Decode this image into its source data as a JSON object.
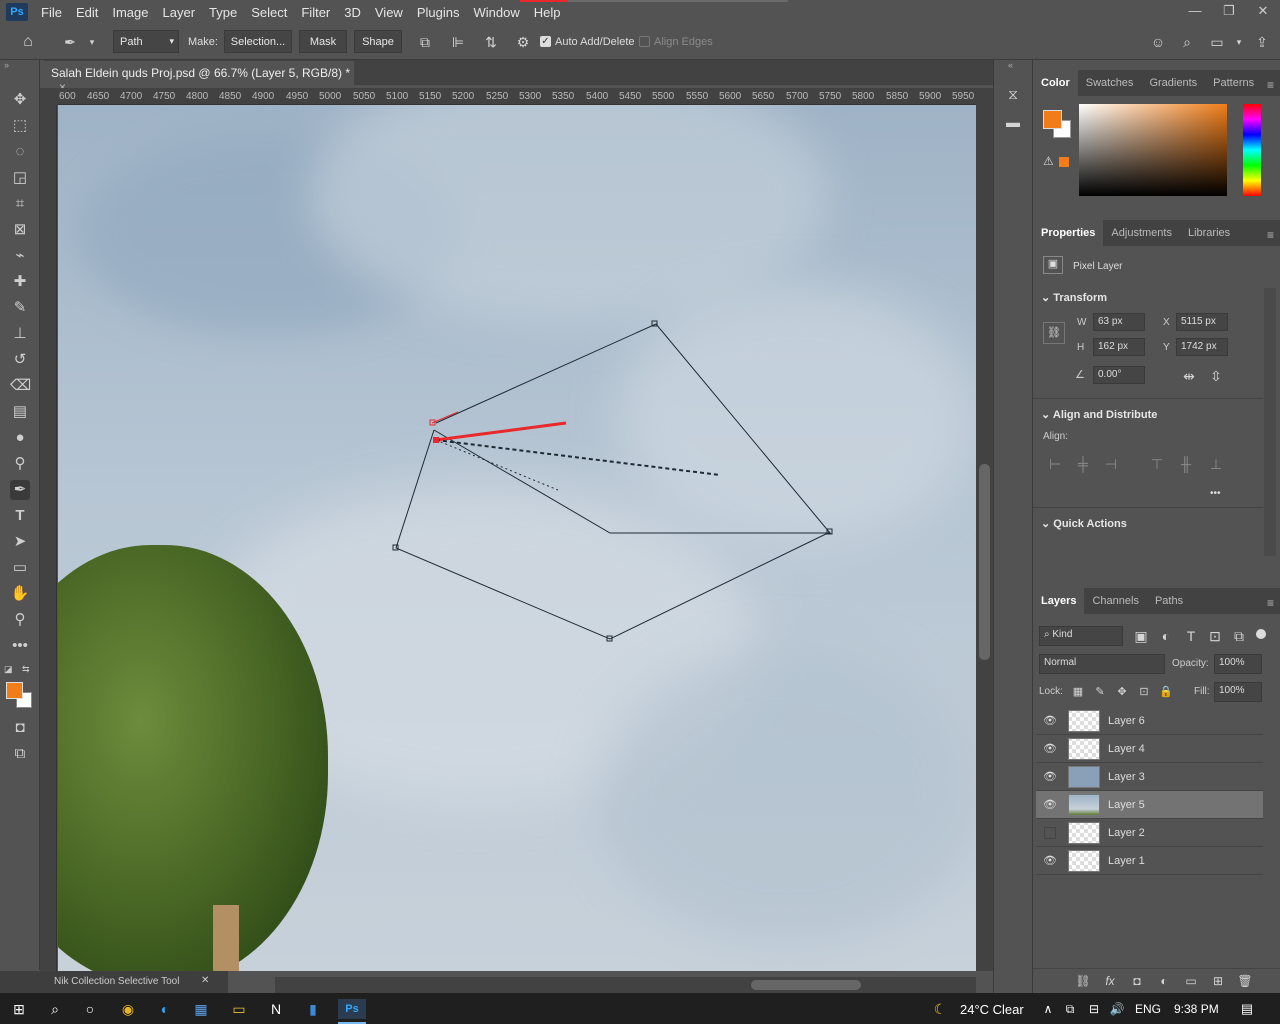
{
  "app": {
    "logo": "Ps"
  },
  "menu": [
    "File",
    "Edit",
    "Image",
    "Layer",
    "Type",
    "Select",
    "Filter",
    "3D",
    "View",
    "Plugins",
    "Window",
    "Help"
  ],
  "window_controls": {
    "minimize": "—",
    "restore": "❐",
    "close": "✕"
  },
  "options": {
    "mode": "Path",
    "make_label": "Make:",
    "selection_btn": "Selection...",
    "mask_btn": "Mask",
    "shape_btn": "Shape",
    "auto_add_delete": "Auto Add/Delete",
    "align_edges": "Align Edges"
  },
  "document": {
    "tab_title": "Salah Eldein quds Proj.psd @ 66.7% (Layer 5, RGB/8) *"
  },
  "ruler": {
    "h_labels": [
      "600",
      "4650",
      "4700",
      "4750",
      "4800",
      "4850",
      "4900",
      "4950",
      "5000",
      "5050",
      "5100",
      "5150",
      "5200",
      "5250",
      "5300",
      "5350",
      "5400",
      "5450",
      "5500",
      "5550",
      "5600",
      "5650",
      "5700",
      "5750",
      "5800",
      "5850",
      "5900",
      "5950"
    ]
  },
  "nik": {
    "label": "Nik Collection Selective Tool"
  },
  "colors": {
    "foreground": "#f07d18",
    "background": "#ffffff",
    "accent": "#e8282a"
  },
  "color_panel": {
    "tabs": [
      "Color",
      "Swatches",
      "Gradients",
      "Patterns"
    ]
  },
  "properties": {
    "tabs": [
      "Properties",
      "Adjustments",
      "Libraries"
    ],
    "layer_type": "Pixel Layer",
    "transform_title": "Transform",
    "w_label": "W",
    "w": "63 px",
    "h_label": "H",
    "h": "162 px",
    "x_label": "X",
    "x": "5115 px",
    "y_label": "Y",
    "y": "1742 px",
    "angle": "0.00°",
    "align_title": "Align and Distribute",
    "align_label": "Align:",
    "more": "•••",
    "quick_title": "Quick Actions"
  },
  "layers_panel": {
    "tabs": [
      "Layers",
      "Channels",
      "Paths"
    ],
    "kind": "Kind",
    "blend": "Normal",
    "opacity_label": "Opacity:",
    "opacity": "100%",
    "lock_label": "Lock:",
    "fill_label": "Fill:",
    "fill": "100%",
    "layers": [
      {
        "name": "Layer 6",
        "visible": "👁"
      },
      {
        "name": "Layer 4",
        "visible": "👁"
      },
      {
        "name": "Layer 3",
        "visible": "👁"
      },
      {
        "name": "Layer 5",
        "visible": "👁"
      },
      {
        "name": "Layer 2",
        "visible": ""
      },
      {
        "name": "Layer 1",
        "visible": "👁"
      }
    ]
  },
  "taskbar": {
    "weather": "24°C  Clear",
    "lang": "ENG",
    "time": "9:38 PM"
  }
}
